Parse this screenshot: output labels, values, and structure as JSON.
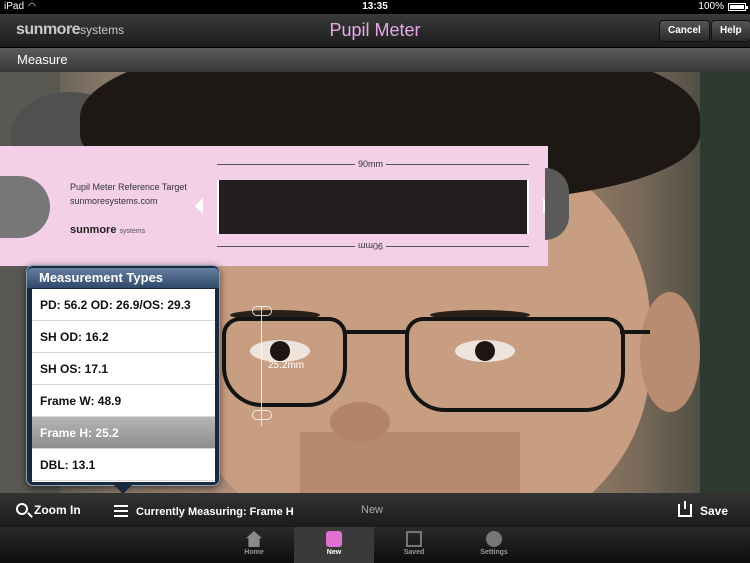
{
  "statusbar": {
    "carrier": "iPad",
    "time": "13:35",
    "battery": "100%",
    "battery_level": 1.0
  },
  "navbar": {
    "brand": "sunmore",
    "brand_suffix": "systems",
    "title": "Pupil Meter",
    "cancel_label": "Cancel",
    "help_label": "Help",
    "title_color": "#e8a8e8"
  },
  "subheader": {
    "title": "Measure"
  },
  "reference_card": {
    "heading": "Pupil Meter Reference Target",
    "url": "sunmoresystems.com",
    "brand": "sunmore",
    "brand_suffix": "systems",
    "top_length": "90mm",
    "bottom_length": "90mm",
    "color": "#f3cfe8"
  },
  "overlay": {
    "frame_h_label": "25.2mm"
  },
  "popover": {
    "title": "Measurement Types",
    "items": [
      {
        "label": "PD: 56.2 OD: 26.9/OS: 29.3"
      },
      {
        "label": "SH OD: 16.2"
      },
      {
        "label": "SH OS: 17.1"
      },
      {
        "label": "Frame W: 48.9"
      },
      {
        "label": "Frame H: 25.2",
        "selected": true
      },
      {
        "label": "DBL: 13.1"
      }
    ]
  },
  "toolbar": {
    "zoom_label": "Zoom In",
    "current_label": "Currently Measuring: Frame H",
    "new_label": "New",
    "save_label": "Save"
  },
  "tabbar": {
    "tabs": [
      {
        "label": "Home",
        "icon": "home-icon"
      },
      {
        "label": "New",
        "icon": "new-patient-icon",
        "active": true
      },
      {
        "label": "Saved",
        "icon": "saved-icon"
      },
      {
        "label": "Settings",
        "icon": "gear-icon"
      }
    ]
  }
}
